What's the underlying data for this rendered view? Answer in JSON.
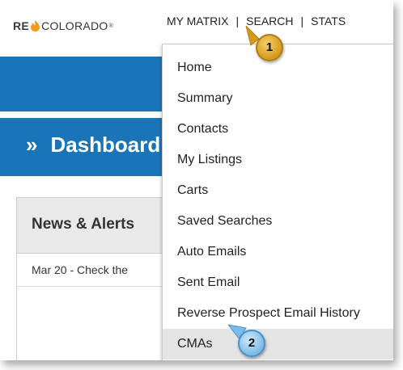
{
  "header": {
    "logo": {
      "re": "RE",
      "brand": "COLORADO",
      "reg": "®"
    },
    "nav": [
      {
        "label": "MY MATRIX"
      },
      {
        "label": "SEARCH"
      },
      {
        "label": "STATS"
      }
    ],
    "separator": "|"
  },
  "dashboard": {
    "chevron": "»",
    "title": "Dashboard"
  },
  "panel": {
    "title": "News & Alerts",
    "row": "Mar 20 - Check the"
  },
  "menu": {
    "items": [
      {
        "label": "Home"
      },
      {
        "label": "Summary"
      },
      {
        "label": "Contacts"
      },
      {
        "label": "My Listings"
      },
      {
        "label": "Carts"
      },
      {
        "label": "Saved Searches"
      },
      {
        "label": "Auto Emails"
      },
      {
        "label": "Sent Email"
      },
      {
        "label": "Reverse Prospect Email History"
      },
      {
        "label": "CMAs"
      }
    ],
    "active": "CMAs"
  },
  "callouts": [
    {
      "number": "1",
      "color": "#e0aa2e"
    },
    {
      "number": "2",
      "color": "#8cc6ee"
    }
  ],
  "colors": {
    "brand_blue": "#1974b8",
    "flame_orange": "#f29a1f",
    "active_row": "#e4e4e4"
  }
}
